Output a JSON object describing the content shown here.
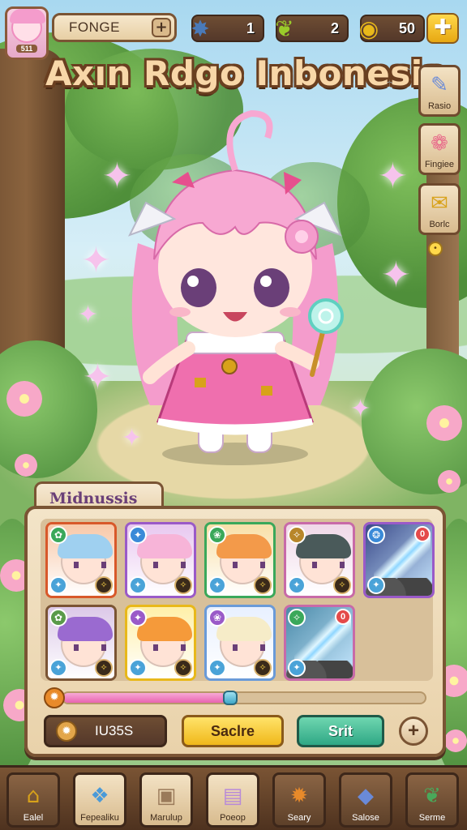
{
  "hud": {
    "player_name": "FONGE",
    "player_level_label": "511",
    "resource_1": "1",
    "resource_2": "2",
    "resource_3": "50"
  },
  "title": "Axın Rdgo Inbonesia",
  "side_menu": [
    {
      "label": "Rasio",
      "icon": "feather-quill-icon"
    },
    {
      "label": "Fingiee",
      "icon": "gift-icon"
    },
    {
      "label": "Borlc",
      "icon": "scroll-icon"
    }
  ],
  "roster": {
    "tab_label": "Midnussis",
    "cards": [
      {
        "kind": "character",
        "hair": "#9fd0f0",
        "bg": "#f8c8a8",
        "frame": "#d8582a",
        "element_color": "#3aa85a",
        "badge_tr": ""
      },
      {
        "kind": "character",
        "hair": "#f7b4d8",
        "bg": "#e8c8f0",
        "frame": "#9a5ac8",
        "element_color": "#3a8ad8",
        "badge_tr": ""
      },
      {
        "kind": "character",
        "hair": "#f39a4a",
        "bg": "#f8e0a8",
        "frame": "#3aa85a",
        "element_color": "#3aa85a",
        "badge_tr": ""
      },
      {
        "kind": "character",
        "hair": "#4a5a5a",
        "bg": "#f0d8e8",
        "frame": "#c86aa8",
        "element_color": "#b8862a",
        "badge_tr": ""
      },
      {
        "kind": "effect",
        "hair": "",
        "bg": "#3a4a8a",
        "frame": "#9a5ac8",
        "element_color": "#3a8ad8",
        "badge_tr": "0"
      },
      {
        "kind": "character",
        "hair": "#9a6ad0",
        "bg": "#dcc8e8",
        "frame": "#7a5434",
        "element_color": "#5a9a4a",
        "badge_tr": ""
      },
      {
        "kind": "character",
        "hair": "#f59a3a",
        "bg": "#fff0a8",
        "frame": "#e8b81a",
        "element_color": "#9a5ac8",
        "badge_tr": ""
      },
      {
        "kind": "character",
        "hair": "#f6ecc8",
        "bg": "#e8f0ff",
        "frame": "#6a9ad8",
        "element_color": "#9a5ac8",
        "badge_tr": ""
      },
      {
        "kind": "effect",
        "hair": "",
        "bg": "#4a8aa8",
        "frame": "#c86aa8",
        "element_color": "#3aa85a",
        "badge_tr": "0"
      }
    ],
    "progress": 0.45,
    "count_label": "IU35S",
    "primary_button": "Saclre",
    "secondary_button": "Srit"
  },
  "nav": [
    {
      "label": "Ealel",
      "icon": "house-icon",
      "dark": true
    },
    {
      "label": "Fepealiku",
      "icon": "crystal-icon",
      "dark": false
    },
    {
      "label": "Marulup",
      "icon": "crate-icon",
      "dark": false
    },
    {
      "label": "Poeop",
      "icon": "book-icon",
      "dark": false
    },
    {
      "label": "Seary",
      "icon": "gear-icon",
      "dark": true
    },
    {
      "label": "Salose",
      "icon": "gem-icon",
      "dark": true
    },
    {
      "label": "Serme",
      "icon": "leaf-icon",
      "dark": true
    }
  ],
  "colors": {
    "panel_bg": "#f3e4c8",
    "frame_brown": "#7a5434",
    "accent_pink": "#e864b0",
    "button_yellow": "#f0b81a",
    "button_green": "#2fa885"
  }
}
